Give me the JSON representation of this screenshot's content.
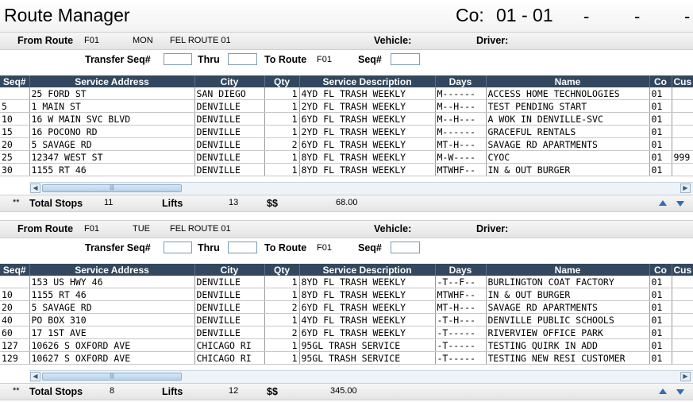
{
  "app": {
    "title": "Route Manager",
    "company_label": "Co:",
    "company_value": "01 - 01",
    "dashes": [
      "-",
      "-",
      "-"
    ]
  },
  "labels": {
    "from_route": "From Route",
    "vehicle": "Vehicle:",
    "driver": "Driver:",
    "transfer_seq": "Transfer Seq#",
    "thru": "Thru",
    "to_route": "To Route",
    "seq": "Seq#",
    "total_stops": "Total Stops",
    "lifts": "Lifts",
    "money": "$$",
    "stars": "**"
  },
  "columns": [
    "Seq#",
    "Service Address",
    "City",
    "Qty",
    "Service Description",
    "Days",
    "Name",
    "Co",
    "Cus"
  ],
  "sections": [
    {
      "from_route_code": "F01",
      "day": "MON",
      "route_name": "FEL ROUTE 01",
      "to_route_code": "F01",
      "transfer_seq_value": "",
      "thru_value": "",
      "seq_value": "",
      "rows": [
        {
          "seq": "",
          "address": "25 FORD ST",
          "city": "SAN DIEGO",
          "qty": "1",
          "desc": "4YD FL TRASH WEEKLY",
          "days": "M------",
          "name": "ACCESS HOME TECHNOLOGIES",
          "co": "01",
          "cus": ""
        },
        {
          "seq": "5",
          "address": "1 MAIN ST",
          "city": "DENVILLE",
          "qty": "1",
          "desc": "2YD FL TRASH WEEKLY",
          "days": "M--H---",
          "name": "TEST PENDING START",
          "co": "01",
          "cus": ""
        },
        {
          "seq": "10",
          "address": "16 W MAIN SVC BLVD",
          "city": "DENVILLE",
          "qty": "1",
          "desc": "6YD FL TRASH WEEKLY",
          "days": "M--H---",
          "name": "A WOK IN DENVILLE-SVC",
          "co": "01",
          "cus": ""
        },
        {
          "seq": "15",
          "address": "16 POCONO RD",
          "city": "DENVILLE",
          "qty": "1",
          "desc": "2YD FL TRASH WEEKLY",
          "days": "M------",
          "name": "GRACEFUL RENTALS",
          "co": "01",
          "cus": ""
        },
        {
          "seq": "20",
          "address": "5 SAVAGE RD",
          "city": "DENVILLE",
          "qty": "2",
          "desc": "6YD FL TRASH WEEKLY",
          "days": "MT-H---",
          "name": "SAVAGE RD APARTMENTS",
          "co": "01",
          "cus": ""
        },
        {
          "seq": "25",
          "address": "12347 WEST ST",
          "city": "DENVILLE",
          "qty": "1",
          "desc": "8YD FL TRASH WEEKLY",
          "days": "M-W----",
          "name": "CYOC",
          "co": "01",
          "cus": "999"
        },
        {
          "seq": "30",
          "address": "1155 RT 46",
          "city": "DENVILLE",
          "qty": "1",
          "desc": "8YD FL TRASH WEEKLY",
          "days": "MTWHF--",
          "name": "IN & OUT BURGER",
          "co": "01",
          "cus": ""
        }
      ],
      "total_stops": "11",
      "lifts": "13",
      "amount": "68.00"
    },
    {
      "from_route_code": "F01",
      "day": "TUE",
      "route_name": "FEL ROUTE 01",
      "to_route_code": "F01",
      "transfer_seq_value": "",
      "thru_value": "",
      "seq_value": "",
      "rows": [
        {
          "seq": "",
          "address": "153 US HWY 46",
          "city": "DENVILLE",
          "qty": "1",
          "desc": "8YD FL TRASH WEEKLY",
          "days": "-T--F--",
          "name": "BURLINGTON COAT FACTORY",
          "co": "01",
          "cus": ""
        },
        {
          "seq": "10",
          "address": "1155 RT 46",
          "city": "DENVILLE",
          "qty": "1",
          "desc": "8YD FL TRASH WEEKLY",
          "days": "MTWHF--",
          "name": "IN & OUT BURGER",
          "co": "01",
          "cus": ""
        },
        {
          "seq": "20",
          "address": "5 SAVAGE RD",
          "city": "DENVILLE",
          "qty": "2",
          "desc": "6YD FL TRASH WEEKLY",
          "days": "MT-H---",
          "name": "SAVAGE RD APARTMENTS",
          "co": "01",
          "cus": ""
        },
        {
          "seq": "40",
          "address": "PO BOX 310",
          "city": "DENVILLE",
          "qty": "1",
          "desc": "4YD FL TRASH WEEKLY",
          "days": "-T-H---",
          "name": "DENVILLE PUBLIC SCHOOLS",
          "co": "01",
          "cus": ""
        },
        {
          "seq": "60",
          "address": "17 1ST AVE",
          "city": "DENVILLE",
          "qty": "2",
          "desc": "6YD FL TRASH WEEKLY",
          "days": "-T-----",
          "name": "RIVERVIEW OFFICE PARK",
          "co": "01",
          "cus": ""
        },
        {
          "seq": "127",
          "address": "10626 S OXFORD AVE",
          "city": "CHICAGO RI",
          "qty": "1",
          "desc": "95GL TRASH SERVICE",
          "days": "-T-----",
          "name": "TESTING QUIRK IN ADD",
          "co": "01",
          "cus": ""
        },
        {
          "seq": "129",
          "address": "10627 S OXFORD AVE",
          "city": "CHICAGO RI",
          "qty": "1",
          "desc": "95GL TRASH SERVICE",
          "days": "-T-----",
          "name": "TESTING NEW RESI CUSTOMER",
          "co": "01",
          "cus": ""
        }
      ],
      "total_stops": "8",
      "lifts": "12",
      "amount": "345.00"
    }
  ],
  "colors": {
    "header_bg": "#33485f",
    "header_text": "#ffffff",
    "arrow_blue": "#2b6fb6"
  },
  "icons": [
    "scroll-left-icon",
    "scroll-right-icon",
    "arrow-up-icon",
    "arrow-down-icon"
  ]
}
